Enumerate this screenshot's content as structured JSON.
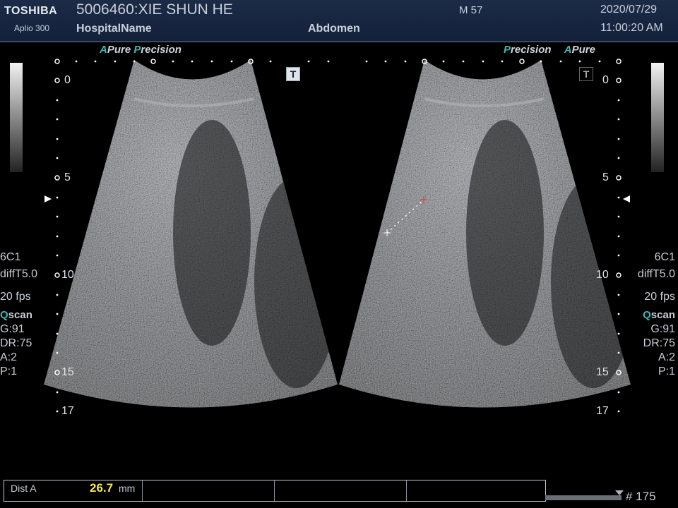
{
  "header": {
    "brand": "TOSHIBA",
    "model": "Aplio 300",
    "patient": "5006460:XIE SHUN HE",
    "hospital": "HospitalName",
    "exam": "Abdomen",
    "sex_age": "M 57",
    "date": "2020/07/29",
    "time": "11:00:20 AM"
  },
  "left_panel": {
    "mode_a": "A",
    "mode_pure": "Pure",
    "mode_p": "P",
    "mode_precision": "recision",
    "t_icon": "T",
    "probe": "6C1",
    "freq": "diffT5.0",
    "fps": "20 fps",
    "qscan_q": "Q",
    "qscan_rest": "scan",
    "gain": "G:91",
    "dr": "DR:75",
    "a": "A:2",
    "p": "P:1"
  },
  "right_panel": {
    "mode_p": "P",
    "mode_precision": "recision",
    "mode_a": "A",
    "mode_pure": "Pure",
    "t_icon": "T",
    "probe": "6C1",
    "freq": "diffT5.0",
    "fps": "20 fps",
    "qscan_q": "Q",
    "qscan_rest": "scan",
    "gain": "G:91",
    "dr": "DR:75",
    "a": "A:2",
    "p": "P:1"
  },
  "depth_labels": [
    "0",
    "5",
    "10",
    "15",
    "17"
  ],
  "measurement": {
    "label": "Dist A",
    "value": "26.7",
    "unit": "mm"
  },
  "frame_counter": "# 175",
  "colors": {
    "header_bg": "#1c2b46",
    "accent_cyan": "#3fb5b5",
    "measure_value": "#f5e84a",
    "caliper_red": "#e04040"
  }
}
